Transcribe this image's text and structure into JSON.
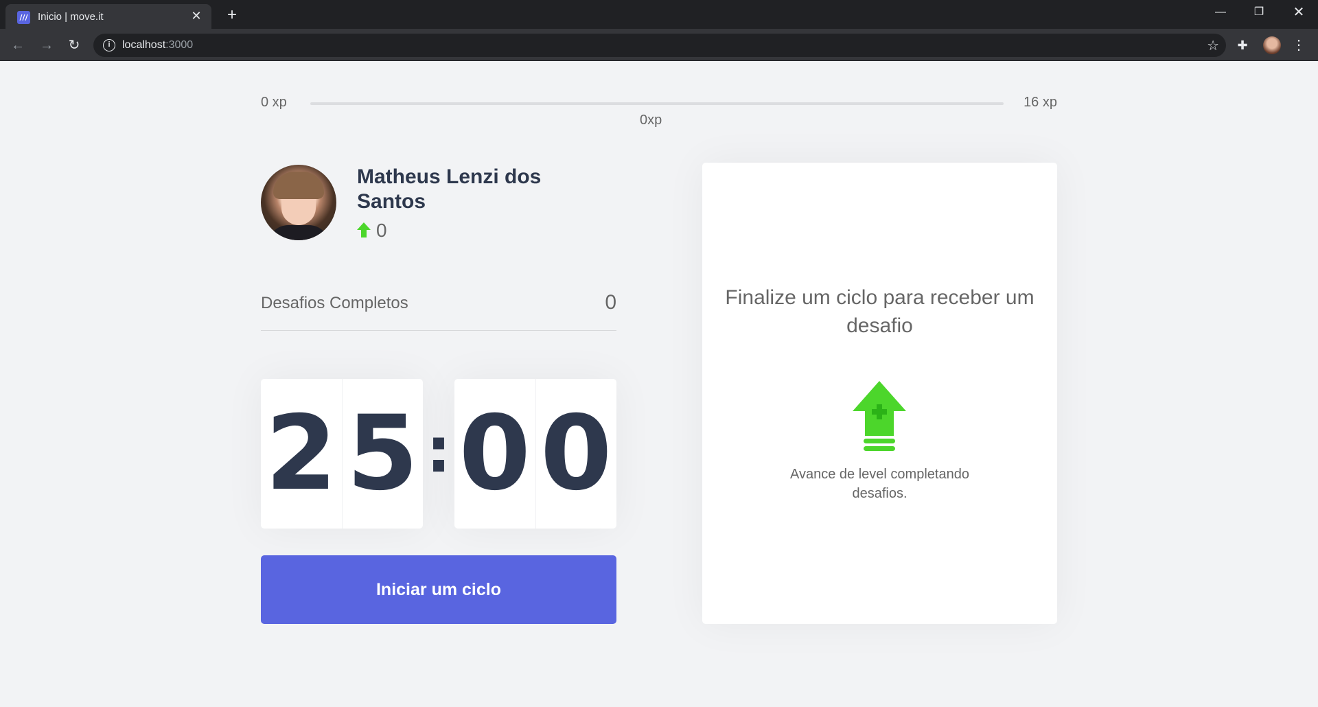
{
  "browser": {
    "tab_title": "Inicio | move.it",
    "tab_favicon": "///",
    "url_host": "localhost",
    "url_port": ":3000"
  },
  "app": {
    "xp": {
      "min_label": "0 xp",
      "max_label": "16 xp",
      "current_label": "0xp",
      "progress_percent": 0
    },
    "profile": {
      "name": "Matheus Lenzi dos Santos",
      "level": "0"
    },
    "completed": {
      "label": "Desafios Completos",
      "value": "0"
    },
    "countdown": {
      "minute_left": "2",
      "minute_right": "5",
      "separator": ":",
      "second_left": "0",
      "second_right": "0"
    },
    "start_button": "Iniciar um ciclo",
    "challenge": {
      "title": "Finalize um ciclo para receber um desafio",
      "description": "Avance de level completando desafios.",
      "icon": "level-up-icon"
    },
    "colors": {
      "accent": "#5965e0",
      "green": "#4cd62b",
      "background": "#f2f3f5",
      "title": "#2e384d",
      "text": "#666666"
    }
  }
}
